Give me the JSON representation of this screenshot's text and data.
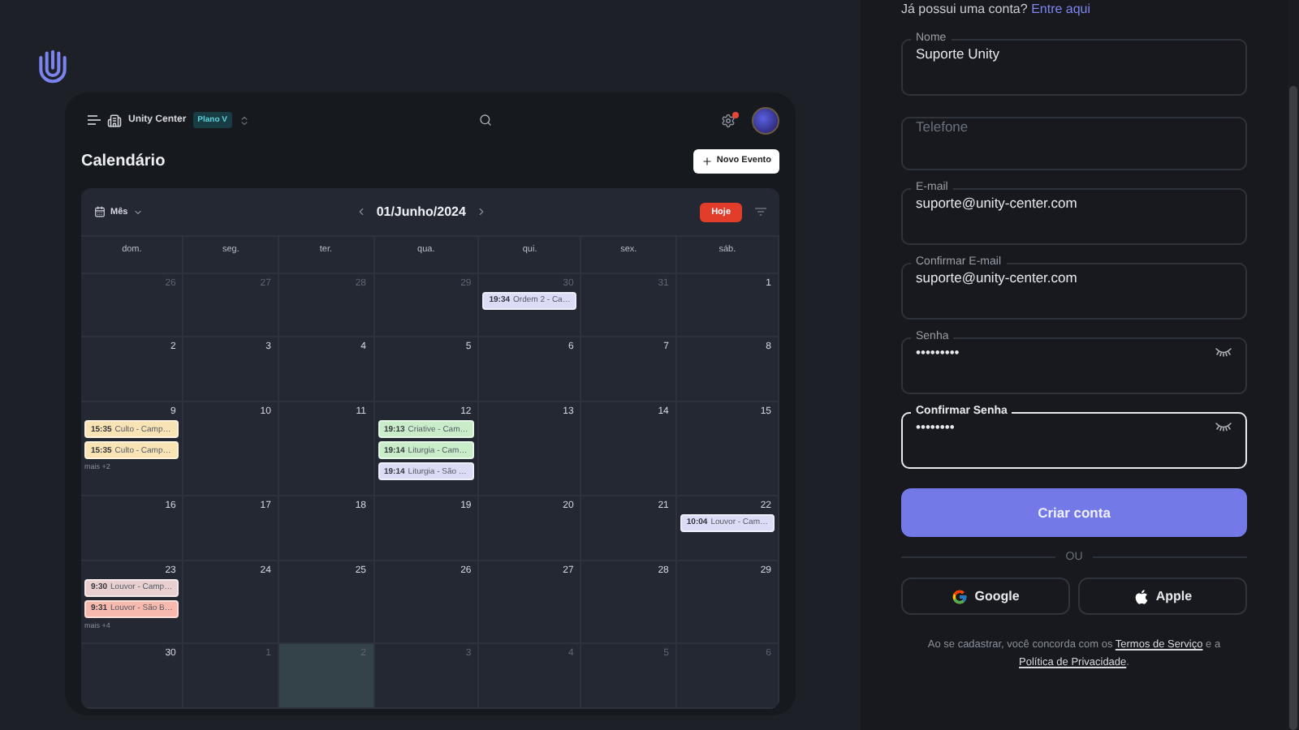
{
  "app": {
    "workspace": "Unity Center",
    "plan": "Plano V",
    "notification": true,
    "page_title": "Calendário",
    "new_event_button": "Novo Evento"
  },
  "calendar": {
    "view": "Mês",
    "period": "01/Junho/2024",
    "today_button": "Hoje",
    "weekdays": [
      "dom.",
      "seg.",
      "ter.",
      "qua.",
      "qui.",
      "sex.",
      "sáb."
    ],
    "weeks": [
      [
        {
          "day": "26",
          "outside": true,
          "highlighted": false
        },
        {
          "day": "27",
          "outside": true,
          "highlighted": false
        },
        {
          "day": "28",
          "outside": true,
          "highlighted": false
        },
        {
          "day": "29",
          "outside": true,
          "highlighted": false
        },
        {
          "day": "30",
          "outside": true,
          "highlighted": false,
          "events": [
            {
              "time": "19:34",
              "title": "Ordem 2 - Ca…",
              "color": "#dcdcf6"
            }
          ]
        },
        {
          "day": "31",
          "outside": true,
          "highlighted": false
        },
        {
          "day": "1",
          "outside": false,
          "highlighted": false
        }
      ],
      [
        {
          "day": "2",
          "outside": false,
          "highlighted": false
        },
        {
          "day": "3",
          "outside": false,
          "highlighted": false
        },
        {
          "day": "4",
          "outside": false,
          "highlighted": false
        },
        {
          "day": "5",
          "outside": false,
          "highlighted": false
        },
        {
          "day": "6",
          "outside": false,
          "highlighted": false
        },
        {
          "day": "7",
          "outside": false,
          "highlighted": false
        },
        {
          "day": "8",
          "outside": false,
          "highlighted": false
        }
      ],
      [
        {
          "day": "9",
          "outside": false,
          "highlighted": false,
          "events": [
            {
              "time": "15:35",
              "title": "Culto - Camp…",
              "color": "#f8e3b4"
            },
            {
              "time": "15:35",
              "title": "Culto - Camp…",
              "color": "#f8e3b4"
            }
          ],
          "more": "mais +2"
        },
        {
          "day": "10",
          "outside": false,
          "highlighted": false
        },
        {
          "day": "11",
          "outside": false,
          "highlighted": false
        },
        {
          "day": "12",
          "outside": false,
          "highlighted": false,
          "events": [
            {
              "time": "19:13",
              "title": "Criative - Cam…",
              "color": "#c9ecc9"
            },
            {
              "time": "19:14",
              "title": "Liturgia - Cam…",
              "color": "#c9ecc9"
            },
            {
              "time": "19:14",
              "title": "Liturgia - São …",
              "color": "#dcdcf6"
            }
          ]
        },
        {
          "day": "13",
          "outside": false,
          "highlighted": false
        },
        {
          "day": "14",
          "outside": false,
          "highlighted": false
        },
        {
          "day": "15",
          "outside": false,
          "highlighted": false
        }
      ],
      [
        {
          "day": "16",
          "outside": false,
          "highlighted": false
        },
        {
          "day": "17",
          "outside": false,
          "highlighted": false
        },
        {
          "day": "18",
          "outside": false,
          "highlighted": false
        },
        {
          "day": "19",
          "outside": false,
          "highlighted": false
        },
        {
          "day": "20",
          "outside": false,
          "highlighted": false
        },
        {
          "day": "21",
          "outside": false,
          "highlighted": false
        },
        {
          "day": "22",
          "outside": false,
          "highlighted": false,
          "events": [
            {
              "time": "10:04",
              "title": "Louvor - Cam…",
              "color": "#dcdcf6"
            }
          ]
        }
      ],
      [
        {
          "day": "23",
          "outside": false,
          "highlighted": false,
          "events": [
            {
              "time": "9:30",
              "title": "Louvor - Camp…",
              "color": "#e8d0d0"
            },
            {
              "time": "9:31",
              "title": "Louvor - São B…",
              "color": "#f7b9ae"
            }
          ],
          "more": "mais +4"
        },
        {
          "day": "24",
          "outside": false,
          "highlighted": false
        },
        {
          "day": "25",
          "outside": false,
          "highlighted": false
        },
        {
          "day": "26",
          "outside": false,
          "highlighted": false
        },
        {
          "day": "27",
          "outside": false,
          "highlighted": false
        },
        {
          "day": "28",
          "outside": false,
          "highlighted": false
        },
        {
          "day": "29",
          "outside": false,
          "highlighted": false
        }
      ],
      [
        {
          "day": "30",
          "outside": false,
          "highlighted": false
        },
        {
          "day": "1",
          "outside": true,
          "highlighted": false
        },
        {
          "day": "2",
          "outside": true,
          "highlighted": true
        },
        {
          "day": "3",
          "outside": true,
          "highlighted": false
        },
        {
          "day": "4",
          "outside": true,
          "highlighted": false
        },
        {
          "day": "5",
          "outside": true,
          "highlighted": false
        },
        {
          "day": "6",
          "outside": true,
          "highlighted": false
        }
      ]
    ]
  },
  "signup": {
    "login_prompt": "Já possui uma conta?",
    "login_link": "Entre aqui",
    "fields": [
      {
        "kind": "text",
        "label": "Nome",
        "value": "Suporte Unity",
        "focused": false
      },
      {
        "kind": "text",
        "placeholder": "Telefone",
        "focused": false
      },
      {
        "kind": "text",
        "label": "E-mail",
        "value": "suporte@unity-center.com",
        "focused": false
      },
      {
        "kind": "text",
        "label": "Confirmar E-mail",
        "value": "suporte@unity-center.com",
        "focused": false
      },
      {
        "kind": "password",
        "label": "Senha",
        "value": "•••••••••",
        "focused": false
      },
      {
        "kind": "password",
        "label": "Confirmar Senha",
        "value": "••••••••",
        "focused": true
      }
    ],
    "submit": "Criar conta",
    "divider": "OU",
    "social": [
      {
        "kind": "google",
        "label": "Google"
      },
      {
        "kind": "apple",
        "label": "Apple"
      }
    ],
    "terms": {
      "before": "Ao se cadastrar, você concorda com os",
      "terms_link": "Termos de Serviço",
      "middle": "e a",
      "privacy_link": "Política de Privacidade",
      "after": "."
    }
  }
}
